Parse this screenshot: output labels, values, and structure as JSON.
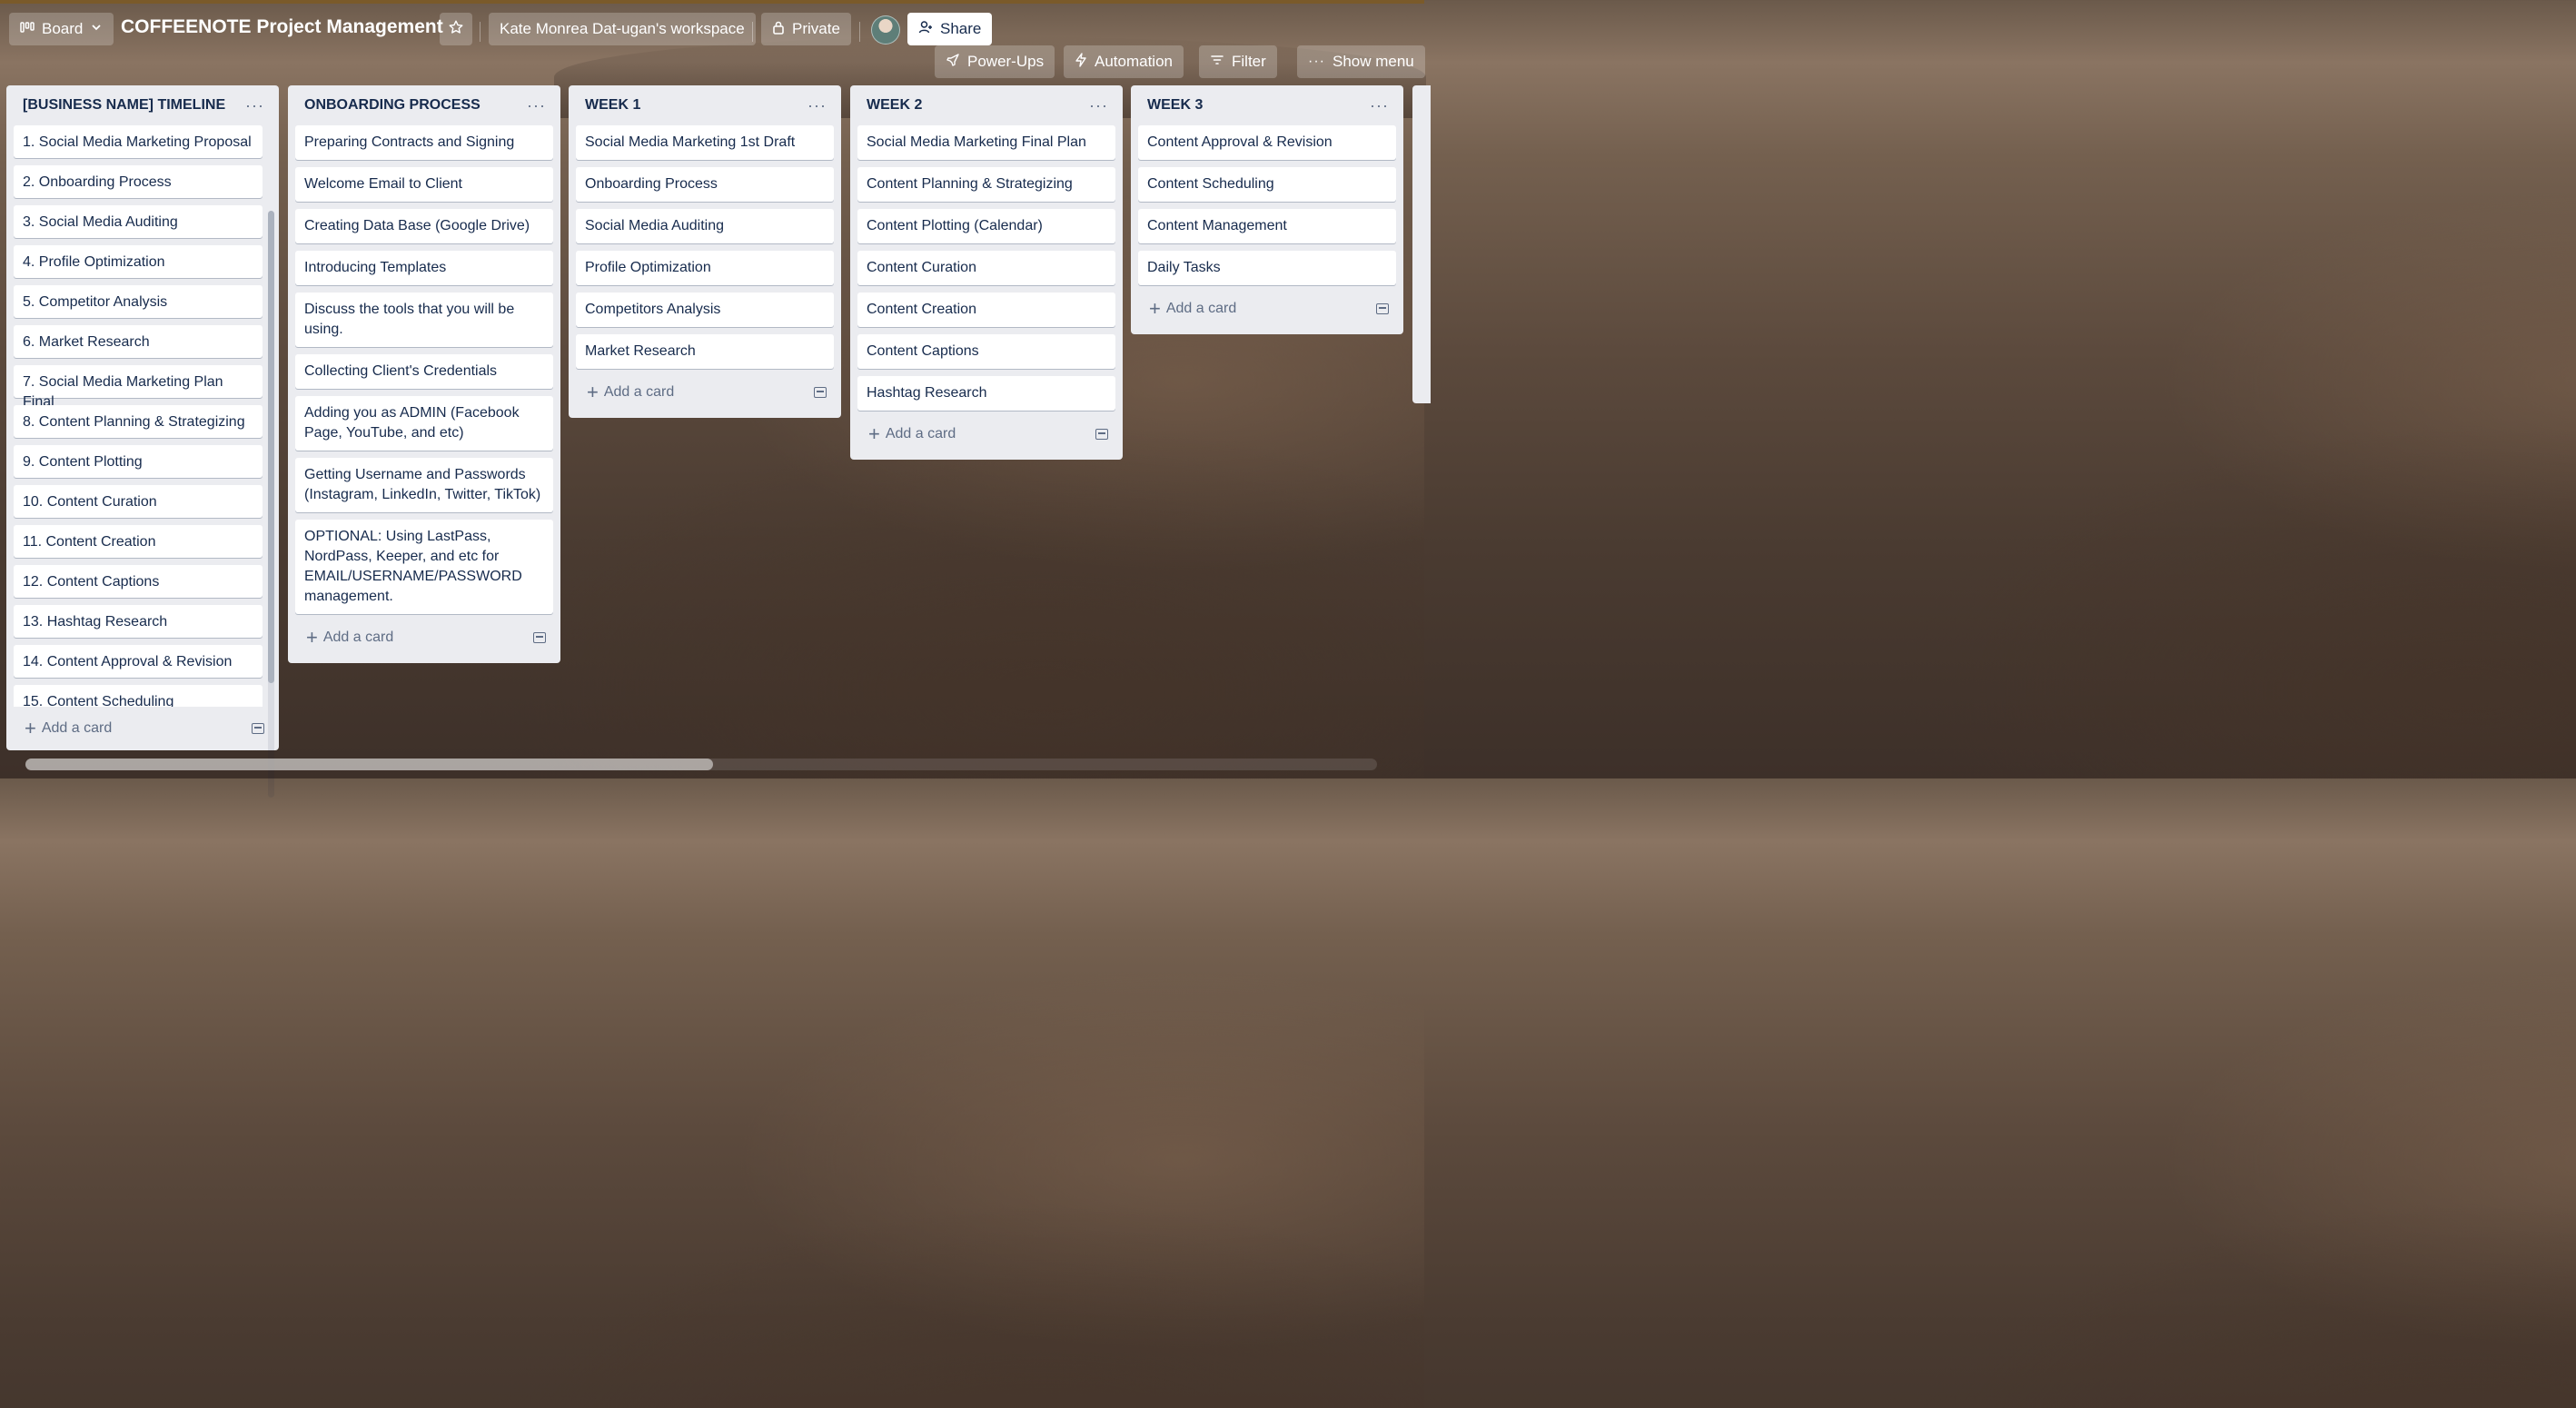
{
  "header": {
    "view_label": "Board",
    "title": "COFFEENOTE Project Management",
    "workspace_label": "Kate Monrea Dat-ugan's workspace",
    "visibility_label": "Private",
    "share_label": "Share",
    "powerups_label": "Power-Ups",
    "automation_label": "Automation",
    "filter_label": "Filter",
    "show_menu_label": "Show menu"
  },
  "add_card_label": "Add a card",
  "lists": [
    {
      "title": "[BUSINESS NAME] TIMELINE",
      "cards": [
        "1. Social Media Marketing Proposal",
        "2. Onboarding Process",
        "3. Social Media Auditing",
        "4. Profile Optimization",
        "5. Competitor Analysis",
        "6. Market Research",
        "7. Social Media Marketing Plan Final",
        "8. Content Planning & Strategizing",
        "9. Content Plotting",
        "10. Content Curation",
        "11. Content Creation",
        "12. Content Captions",
        "13. Hashtag Research",
        "14. Content Approval & Revision",
        "15. Content Scheduling"
      ]
    },
    {
      "title": "ONBOARDING PROCESS",
      "cards": [
        "Preparing Contracts and Signing",
        "Welcome Email to Client",
        "Creating Data Base (Google Drive)",
        "Introducing Templates",
        "Discuss the tools that you will be using.",
        "Collecting Client's Credentials",
        "Adding you as ADMIN (Facebook Page, YouTube, and etc)",
        "Getting Username and Passwords (Instagram, LinkedIn, Twitter, TikTok)",
        "OPTIONAL: Using LastPass, NordPass, Keeper, and etc for EMAIL/USERNAME/PASSWORD management."
      ]
    },
    {
      "title": "WEEK 1",
      "cards": [
        "Social Media Marketing 1st Draft",
        "Onboarding Process",
        "Social Media Auditing",
        "Profile Optimization",
        "Competitors Analysis",
        "Market Research"
      ]
    },
    {
      "title": "WEEK 2",
      "cards": [
        "Social Media Marketing Final Plan",
        "Content Planning & Strategizing",
        "Content Plotting (Calendar)",
        "Content Curation",
        "Content Creation",
        "Content Captions",
        "Hashtag Research"
      ]
    },
    {
      "title": "WEEK 3",
      "cards": [
        "Content Approval & Revision",
        "Content Scheduling",
        "Content Management",
        "Daily Tasks"
      ]
    }
  ]
}
